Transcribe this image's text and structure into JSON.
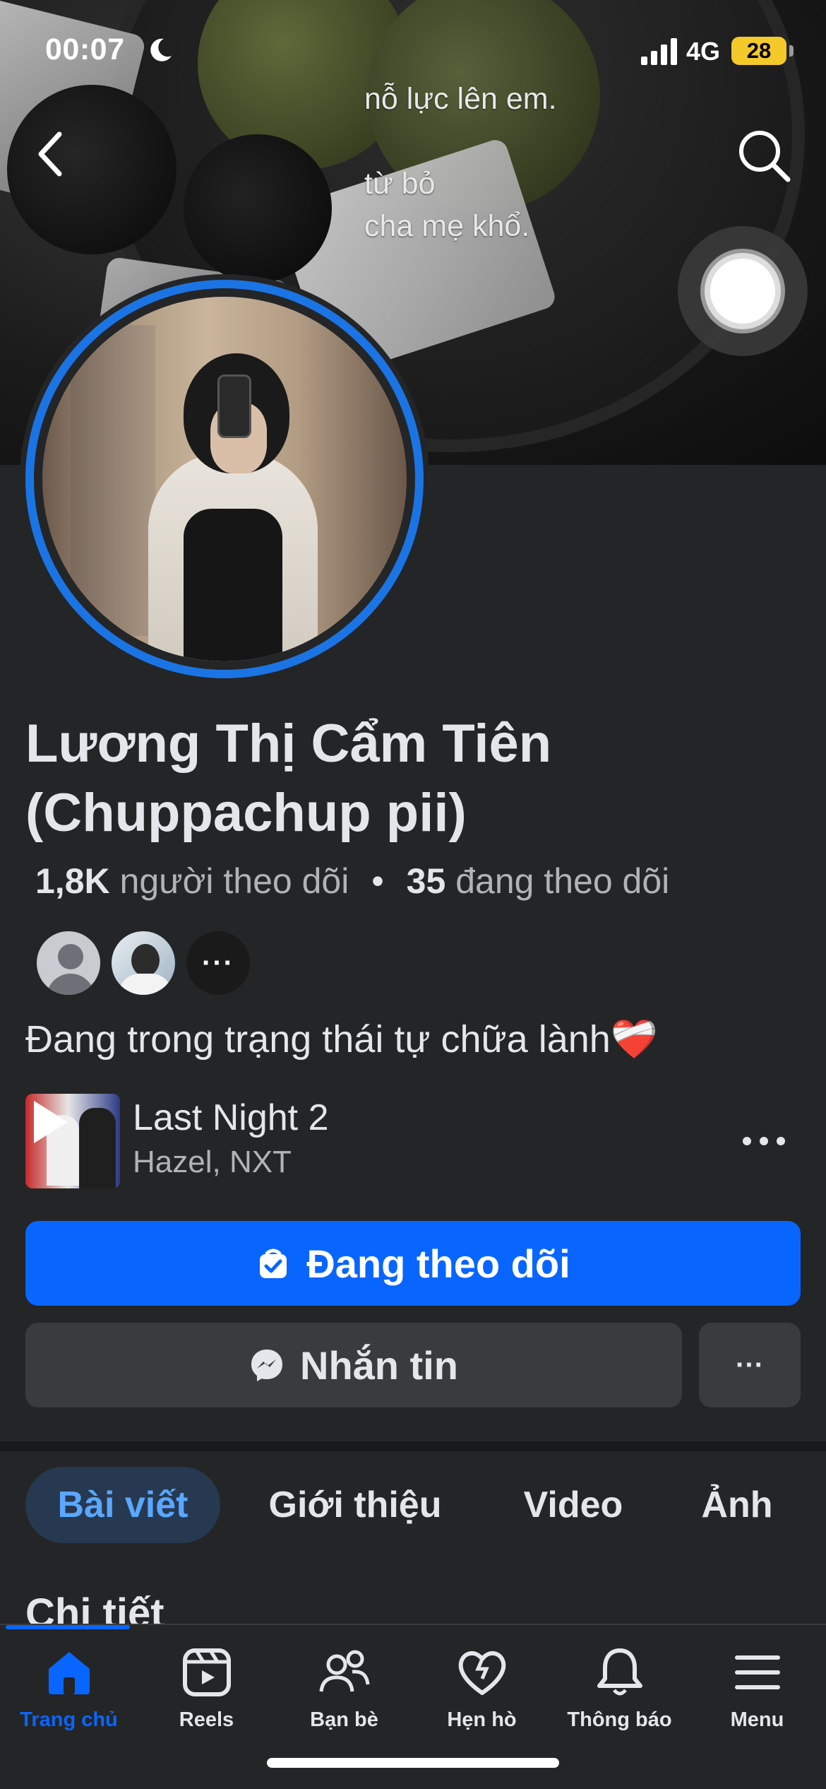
{
  "status_bar": {
    "time": "00:07",
    "network": "4G",
    "battery": "28"
  },
  "cover": {
    "text_lines": [
      "nỗ lực lên em.",
      "",
      "từ bỏ",
      "cha mẹ khổ."
    ]
  },
  "profile": {
    "name": "Lương Thị Cẩm Tiên (Chuppachup pii)",
    "followers_count": "1,8K",
    "followers_label": "người theo dõi",
    "separator": "•",
    "following_count": "35",
    "following_label": "đang theo dõi",
    "mutuals_more": "···",
    "bio": "Đang trong trạng thái tự chữa lành❤️‍🩹"
  },
  "music": {
    "title": "Last Night 2",
    "artist": "Hazel, NXT",
    "more": "···"
  },
  "buttons": {
    "follow": "Đang theo dõi",
    "message": "Nhắn tin",
    "more": "···"
  },
  "tabs": [
    {
      "label": "Bài viết",
      "active": true
    },
    {
      "label": "Giới thiệu",
      "active": false
    },
    {
      "label": "Video",
      "active": false
    },
    {
      "label": "Ảnh",
      "active": false
    }
  ],
  "section_title": "Chi tiết",
  "bottom_nav": [
    {
      "label": "Trang chủ",
      "icon": "home-icon",
      "active": true
    },
    {
      "label": "Reels",
      "icon": "reels-icon",
      "active": false
    },
    {
      "label": "Bạn bè",
      "icon": "friends-icon",
      "active": false
    },
    {
      "label": "Hẹn hò",
      "icon": "dating-heart-icon",
      "active": false
    },
    {
      "label": "Thông báo",
      "icon": "bell-icon",
      "active": false
    },
    {
      "label": "Menu",
      "icon": "menu-icon",
      "active": false
    }
  ],
  "colors": {
    "accent": "#0866ff",
    "background": "#242526",
    "button_secondary": "#3a3b3c",
    "battery": "#f4c92a"
  }
}
